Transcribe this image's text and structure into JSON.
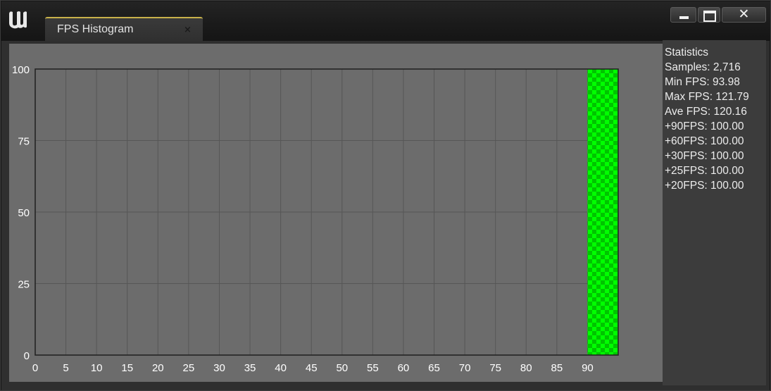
{
  "window": {
    "logo": "unreal-engine-logo",
    "tab_title": "FPS Histogram",
    "tab_close_glyph": "×",
    "controls": {
      "minimize_icon": "minimize-icon",
      "maximize_icon": "maximize-icon",
      "close_glyph": "✕"
    }
  },
  "statistics": {
    "heading": "Statistics",
    "lines": [
      "Samples: 2,716",
      "Min FPS: 93.98",
      "Max FPS: 121.79",
      "Ave FPS: 120.16",
      "+90FPS: 100.00",
      "+60FPS: 100.00",
      "+30FPS: 100.00",
      "+25FPS: 100.00",
      "+20FPS: 100.00"
    ]
  },
  "chart_data": {
    "type": "bar",
    "x_ticks": [
      "0",
      "5",
      "10",
      "15",
      "20",
      "25",
      "30",
      "35",
      "40",
      "45",
      "50",
      "55",
      "60",
      "65",
      "70",
      "75",
      "80",
      "85",
      "90"
    ],
    "y_ticks": [
      "0",
      "25",
      "50",
      "75",
      "100"
    ],
    "xlim": [
      0,
      95
    ],
    "ylim": [
      0,
      100
    ],
    "bars": [
      {
        "x_start": 90,
        "x_end": 95,
        "value": 100,
        "color": "#00ff00"
      }
    ],
    "grid": true,
    "colors": {
      "plot_background": "#6c6c6c",
      "grid": "#565656",
      "axis": "#1f1f1f",
      "bar_primary": "#00ff00",
      "bar_secondary": "#00c400"
    }
  }
}
